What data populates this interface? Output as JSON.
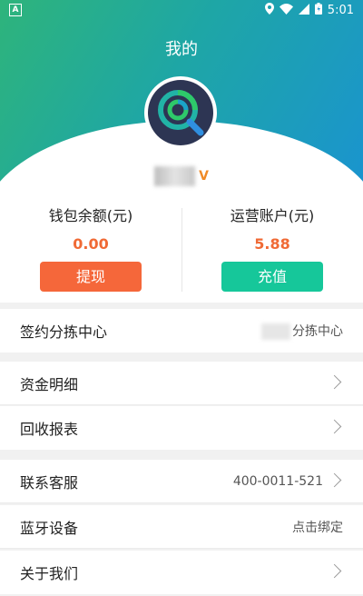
{
  "status_bar": {
    "time": "5:01",
    "left_icon": "A"
  },
  "header": {
    "title": "我的"
  },
  "wallet": {
    "balance_label": "钱包余额(元)",
    "balance_value": "0.00",
    "withdraw_label": "提现",
    "operating_label": "运营账户(元)",
    "operating_value": "5.88",
    "recharge_label": "充值"
  },
  "rows": {
    "contract": {
      "title": "签约分拣中心",
      "value": "分拣中心"
    },
    "funds": {
      "title": "资金明细"
    },
    "recycle": {
      "title": "回收报表"
    },
    "support": {
      "title": "联系客服",
      "value": "400-0011-521"
    },
    "bluetooth": {
      "title": "蓝牙设备",
      "value": "点击绑定"
    },
    "about": {
      "title": "关于我们"
    }
  },
  "colors": {
    "gradient_start": "#2eb47b",
    "gradient_end": "#1a93d1",
    "accent_orange": "#f5673a",
    "accent_green": "#16c79a",
    "amount_color": "#f06a35"
  }
}
